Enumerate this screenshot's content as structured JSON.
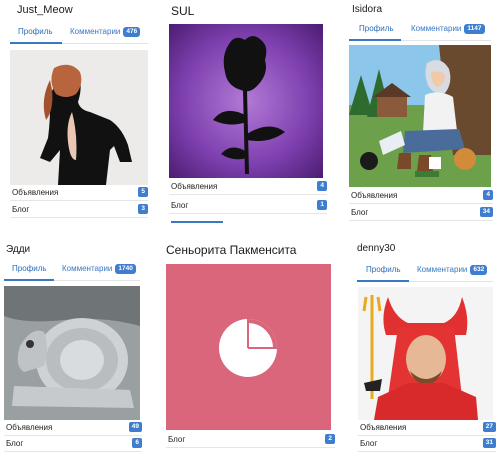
{
  "users": [
    {
      "name": "Just_Meow",
      "tab_profile": "Профиль",
      "tab_comments": "Комментарии",
      "comments_count": "476",
      "ads_label": "Объявления",
      "ads_count": "5",
      "blog_label": "Блог",
      "blog_count": "3"
    },
    {
      "name": "SUL",
      "ads_label": "Объявления",
      "ads_count": "4",
      "blog_label": "Блог",
      "blog_count": "1"
    },
    {
      "name": "Isidora",
      "tab_profile": "Профиль",
      "tab_comments": "Комментарии",
      "comments_count": "1147",
      "ads_label": "Объявления",
      "ads_count": "4",
      "blog_label": "Блог",
      "blog_count": "34"
    },
    {
      "name": "Эдди",
      "tab_profile": "Профиль",
      "tab_comments": "Комментарии",
      "comments_count": "1740",
      "ads_label": "Объявления",
      "ads_count": "49",
      "blog_label": "Блог",
      "blog_count": "6"
    },
    {
      "name": "Сеньорита Пакменсита",
      "blog_label": "Блог",
      "blog_count": "2"
    },
    {
      "name": "denny30",
      "tab_profile": "Профиль",
      "tab_comments": "Комментарии",
      "comments_count": "632",
      "ads_label": "Объявления",
      "ads_count": "27",
      "blog_label": "Блог",
      "blog_count": "31"
    }
  ],
  "colors": {
    "accent": "#3b78c4",
    "badge": "#3f7ecf",
    "pacman_bg": "#d9667a",
    "sul_bg": "#7d3fae"
  },
  "icons": {
    "pie": "pie-chart-icon"
  }
}
